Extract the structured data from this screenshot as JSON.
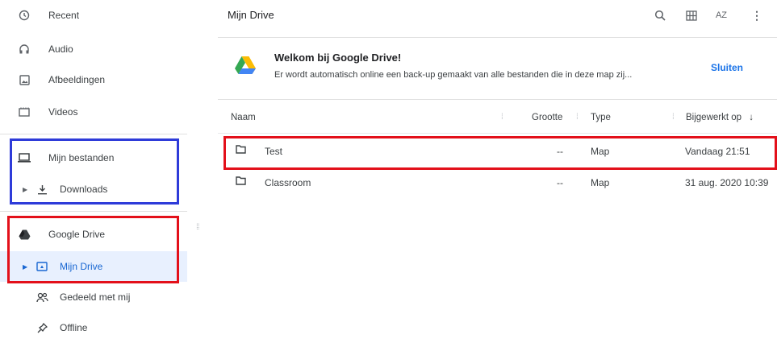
{
  "sidebar": {
    "recent": "Recent",
    "audio": "Audio",
    "images": "Afbeeldingen",
    "videos": "Videos",
    "my_files": "Mijn bestanden",
    "downloads": "Downloads",
    "google_drive": "Google Drive",
    "my_drive": "Mijn Drive",
    "shared": "Gedeeld met mij",
    "offline": "Offline"
  },
  "header": {
    "title": "Mijn Drive",
    "sort_label": "AZ"
  },
  "banner": {
    "title": "Welkom bij Google Drive!",
    "text": "Er wordt automatisch online een back-up gemaakt van alle bestanden die in deze map zij...",
    "close": "Sluiten"
  },
  "columns": {
    "name": "Naam",
    "size": "Grootte",
    "type": "Type",
    "updated": "Bijgewerkt op"
  },
  "files": [
    {
      "name": "Test",
      "size": "--",
      "type": "Map",
      "updated": "Vandaag 21:51"
    },
    {
      "name": "Classroom",
      "size": "--",
      "type": "Map",
      "updated": "31 aug. 2020 10:39"
    }
  ],
  "colors": {
    "accent": "#1a73e8",
    "highlight_red": "#e3101a",
    "highlight_blue": "#2e3bd9",
    "selected_bg": "#e8f0fe"
  }
}
